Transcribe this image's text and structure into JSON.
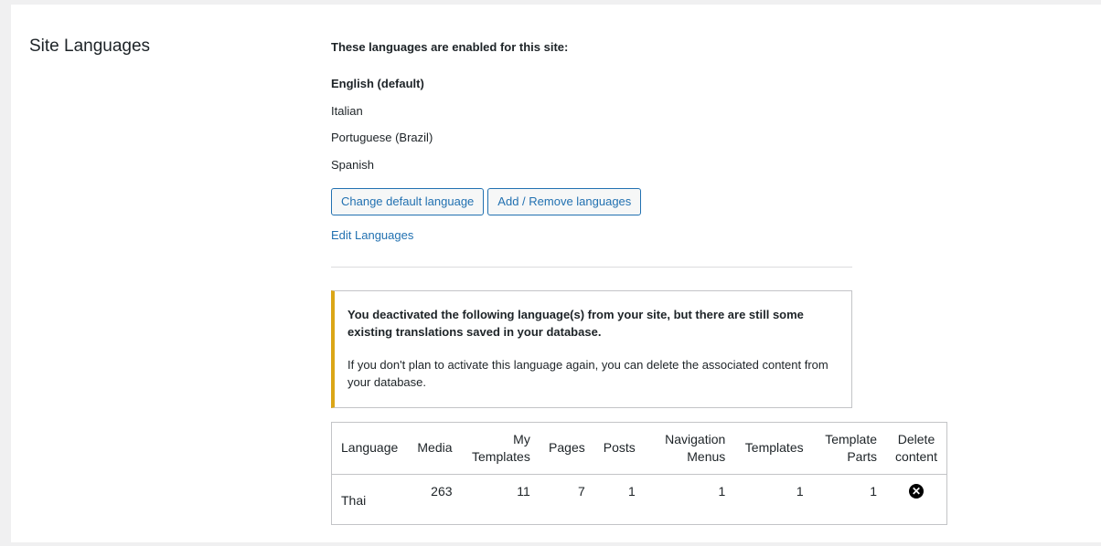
{
  "section_title": "Site Languages",
  "intro": "These languages are enabled for this site:",
  "languages": [
    "English (default)",
    "Italian",
    "Portuguese (Brazil)",
    "Spanish"
  ],
  "buttons": {
    "change_default": "Change default language",
    "add_remove": "Add / Remove languages"
  },
  "edit_link": "Edit Languages",
  "notice": {
    "strong": "You deactivated the following language(s) from your site, but there are still some existing translations saved in your database.",
    "body": "If you don't plan to activate this language again, you can delete the associated content from your database."
  },
  "table": {
    "headers": [
      "Language",
      "Media",
      "My Templates",
      "Pages",
      "Posts",
      "Navigation Menus",
      "Templates",
      "Template Parts",
      "Delete content"
    ],
    "rows": [
      {
        "language": "Thai",
        "media": "263",
        "my_templates": "11",
        "pages": "7",
        "posts": "1",
        "navigation_menus": "1",
        "templates": "1",
        "template_parts": "1",
        "delete_icon": "close-circle-icon"
      }
    ]
  },
  "colors": {
    "accent": "#2271b1",
    "warning_border": "#dba617",
    "background": "#f0f0f1"
  }
}
